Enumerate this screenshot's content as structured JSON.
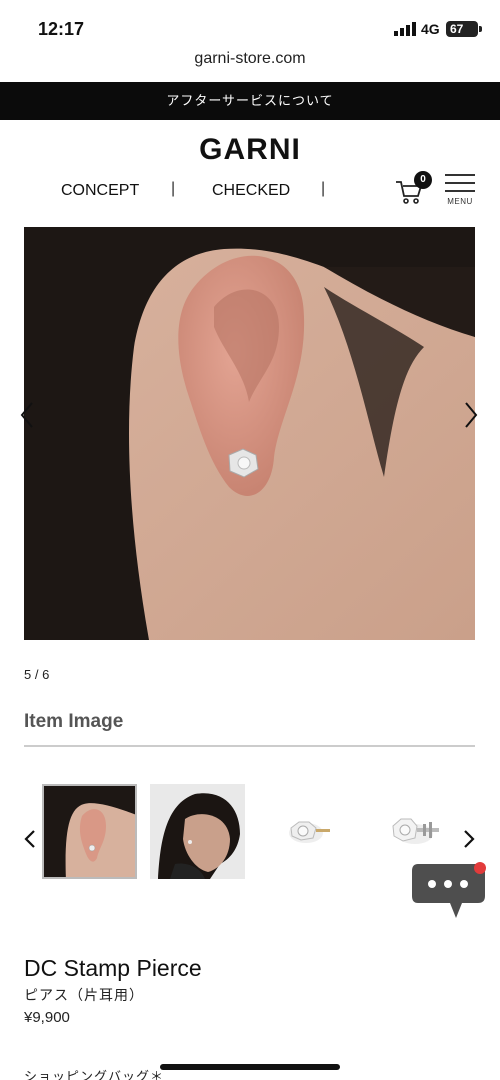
{
  "status_bar": {
    "time": "12:17",
    "network": "4G",
    "battery": "67"
  },
  "browser": {
    "url": "garni-store.com"
  },
  "announcement": "アフターサービスについて",
  "header": {
    "logo": "GARNI",
    "nav": [
      "CONCEPT",
      "CHECKED"
    ],
    "separator": "|",
    "cart_count": "0",
    "menu_label": "MENU"
  },
  "gallery": {
    "counter": "5 / 6",
    "section_title": "Item Image"
  },
  "product": {
    "name": "DC Stamp Pierce",
    "subtitle": "ピアス（片耳用）",
    "price": "¥9,900",
    "bag_label": "ショッピングバッグ＊"
  },
  "icons": [
    "signal-icon",
    "cart-icon",
    "menu-icon",
    "chevron-left-icon",
    "chevron-right-icon",
    "chat-icon"
  ]
}
